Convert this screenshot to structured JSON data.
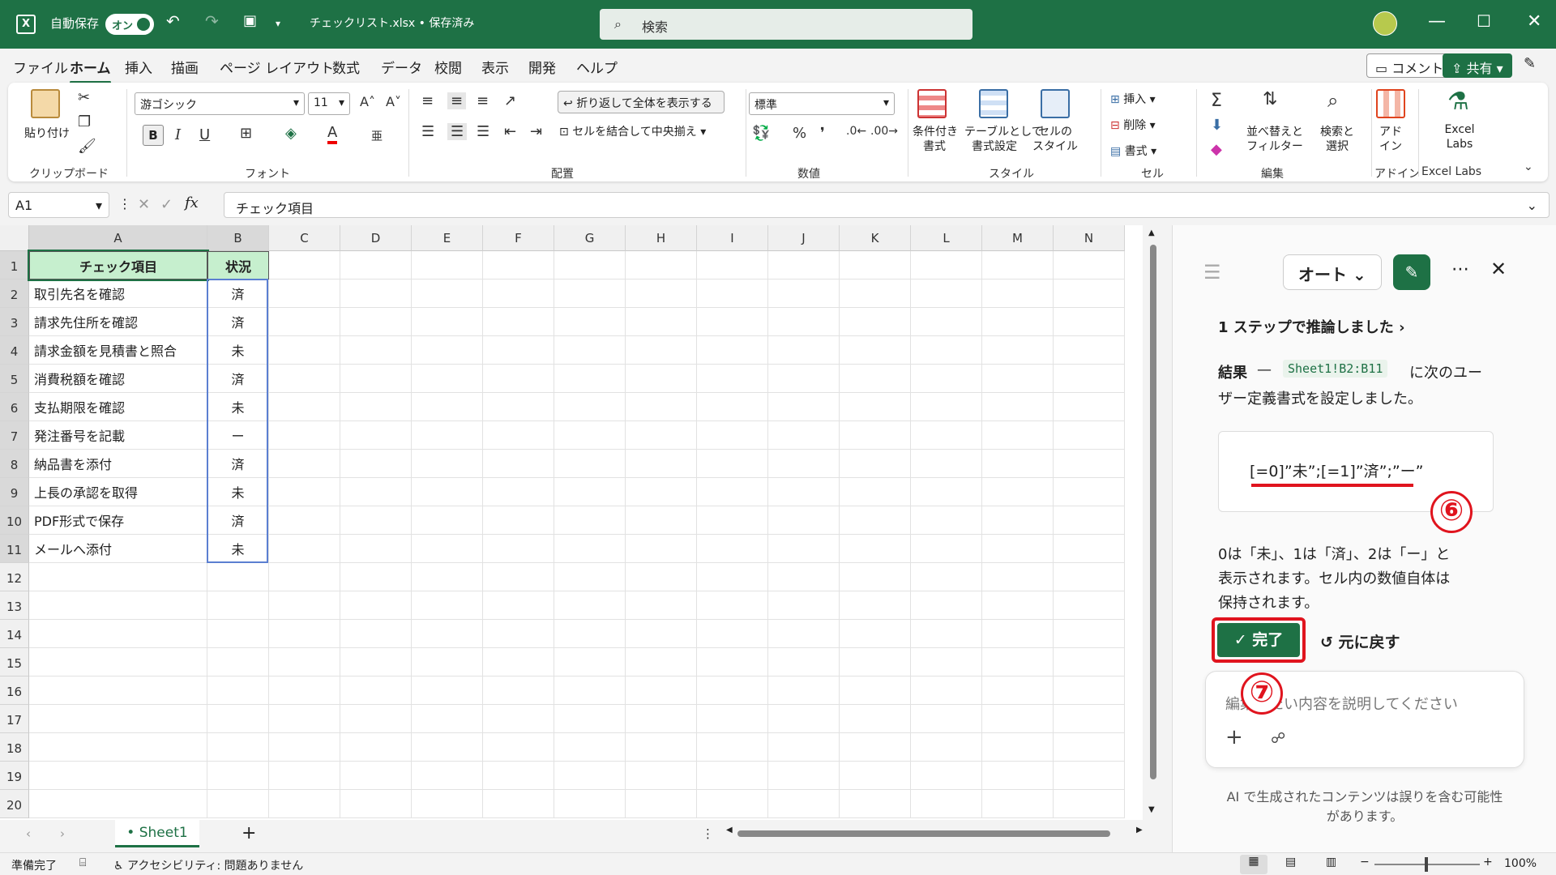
{
  "titlebar": {
    "autosave_label": "自動保存",
    "autosave_toggle": "オン",
    "filename": "チェックリスト.xlsx • 保存済み",
    "search_placeholder": "検索"
  },
  "tabs": [
    "ファイル",
    "ホーム",
    "挿入",
    "描画",
    "ページ レイアウト",
    "数式",
    "データ",
    "校閲",
    "表示",
    "開発",
    "ヘルプ"
  ],
  "active_tab": "ホーム",
  "top_buttons": {
    "comment": "コメント",
    "share": "共有"
  },
  "ribbon": {
    "clipboard": {
      "paste": "貼り付け",
      "group": "クリップボード"
    },
    "font": {
      "name": "游ゴシック",
      "size": "11",
      "group": "フォント"
    },
    "alignment": {
      "wrap": "折り返して全体を表示する",
      "merge": "セルを結合して中央揃え",
      "group": "配置"
    },
    "number": {
      "format": "標準",
      "group": "数値"
    },
    "style": {
      "conditional": "条件付き",
      "conditional2": "書式",
      "table": "テーブルとして",
      "table2": "書式設定",
      "cellstyle": "セルの",
      "cellstyle2": "スタイル",
      "group": "スタイル"
    },
    "cells": {
      "insert": "挿入",
      "delete": "削除",
      "format": "書式",
      "group": "セル"
    },
    "editing": {
      "sort": "並べ替えと",
      "sort2": "フィルター",
      "find": "検索と",
      "find2": "選択",
      "group": "編集"
    },
    "addins": {
      "label": "アド",
      "label2": "イン",
      "group": "アドイン"
    },
    "labs": {
      "label": "Excel",
      "label2": "Labs",
      "group": "Excel Labs"
    }
  },
  "formula_bar": {
    "cell_ref": "A1",
    "content": "チェック項目"
  },
  "columns": [
    "A",
    "B",
    "C",
    "D",
    "E",
    "F",
    "G",
    "H",
    "I",
    "J",
    "K",
    "L",
    "M",
    "N"
  ],
  "rows": [
    "1",
    "2",
    "3",
    "4",
    "5",
    "6",
    "7",
    "8",
    "9",
    "10",
    "11",
    "12",
    "13",
    "14",
    "15",
    "16",
    "17",
    "18",
    "19",
    "20"
  ],
  "table": {
    "header": {
      "a": "チェック項目",
      "b": "状況"
    },
    "rows": [
      {
        "a": "取引先名を確認",
        "b": "済"
      },
      {
        "a": "請求先住所を確認",
        "b": "済"
      },
      {
        "a": "請求金額を見積書と照合",
        "b": "未"
      },
      {
        "a": "消費税額を確認",
        "b": "済"
      },
      {
        "a": "支払期限を確認",
        "b": "未"
      },
      {
        "a": "発注番号を記載",
        "b": "ー"
      },
      {
        "a": "納品書を添付",
        "b": "済"
      },
      {
        "a": "上長の承認を取得",
        "b": "未"
      },
      {
        "a": "PDF形式で保存",
        "b": "済"
      },
      {
        "a": "メールへ添付",
        "b": "未"
      }
    ]
  },
  "sheet_tab": "Sheet1",
  "status": {
    "ready": "準備完了",
    "accessibility": "アクセシビリティ: 問題ありません",
    "zoom": "100%"
  },
  "pane": {
    "mode": "オート",
    "reasoning": "1 ステップで推論しました",
    "result_bold": "結果",
    "result_dash": "—",
    "range": "Sheet1!B2:B11",
    "result_text1": "に次のユー",
    "result_text2": "ザー定義書式を設定しました。",
    "format_code": "[=0]”未”;[=1]”済”;”ー”",
    "explain1": "0は「未」、1は「済」、2は「ー」と",
    "explain2": "表示されます。セル内の数値自体は",
    "explain3": "保持されます。",
    "done": "完了",
    "undo": "元に戻す",
    "input_placeholder": "編集したい内容を説明してください",
    "disclaimer1": "AI で生成されたコンテンツは誤りを含む可能性",
    "disclaimer2": "があります。",
    "marker6": "⑥",
    "marker7": "⑦"
  },
  "colors": {
    "excel_green": "#1e7145",
    "header_fill": "#c6efce",
    "marker_red": "#e0141e"
  }
}
